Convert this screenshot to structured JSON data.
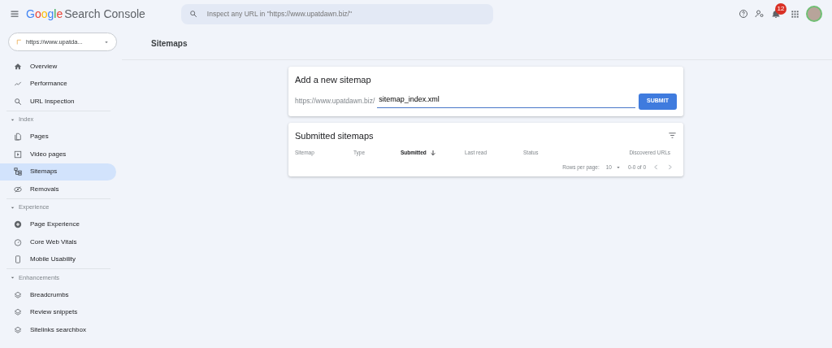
{
  "header": {
    "logo_brand": "Google",
    "logo_product": "Search Console",
    "search": {
      "placeholder": "Inspect any URL in \"https://www.upatdawn.biz/\""
    },
    "notification_count": "12"
  },
  "property": {
    "label": "https://www.upatda..."
  },
  "nav": [
    {
      "kind": "item",
      "label": "Overview",
      "selected": false
    },
    {
      "kind": "item",
      "label": "Performance",
      "selected": false
    },
    {
      "kind": "item",
      "label": "URL Inspection",
      "selected": false
    },
    {
      "kind": "section",
      "label": "Index",
      "expanded": true,
      "children": [
        {
          "kind": "item",
          "label": "Pages",
          "selected": false
        },
        {
          "kind": "item",
          "label": "Video pages",
          "selected": false
        },
        {
          "kind": "item",
          "label": "Sitemaps",
          "selected": true
        },
        {
          "kind": "item",
          "label": "Removals",
          "selected": false
        }
      ]
    },
    {
      "kind": "section",
      "label": "Experience",
      "expanded": true,
      "children": [
        {
          "kind": "item",
          "label": "Page Experience",
          "selected": false
        },
        {
          "kind": "item",
          "label": "Core Web Vitals",
          "selected": false
        },
        {
          "kind": "item",
          "label": "Mobile Usability",
          "selected": false
        }
      ]
    },
    {
      "kind": "section",
      "label": "Enhancements",
      "expanded": true,
      "children": [
        {
          "kind": "item",
          "label": "Breadcrumbs",
          "selected": false
        },
        {
          "kind": "item",
          "label": "Review snippets",
          "selected": false
        },
        {
          "kind": "item",
          "label": "Sitelinks searchbox",
          "selected": false
        }
      ]
    }
  ],
  "page_title": "Sitemaps",
  "add_sitemap": {
    "title": "Add a new sitemap",
    "prefix": "https://www.upatdawn.biz/",
    "value": "sitemap_index.xml",
    "button": "SUBMIT"
  },
  "submitted_sitemaps": {
    "title": "Submitted sitemaps",
    "columns": [
      {
        "label": "Sitemap",
        "sorted": false
      },
      {
        "label": "Type",
        "sorted": false
      },
      {
        "label": "Submitted",
        "sorted": true
      },
      {
        "label": "Last read",
        "sorted": false
      },
      {
        "label": "Status",
        "sorted": false
      },
      {
        "label": "Discovered URLs",
        "sorted": false
      }
    ],
    "rows_per_page_label": "Rows per page:",
    "rows_per_page": "10",
    "range": "0-0 of 0"
  }
}
